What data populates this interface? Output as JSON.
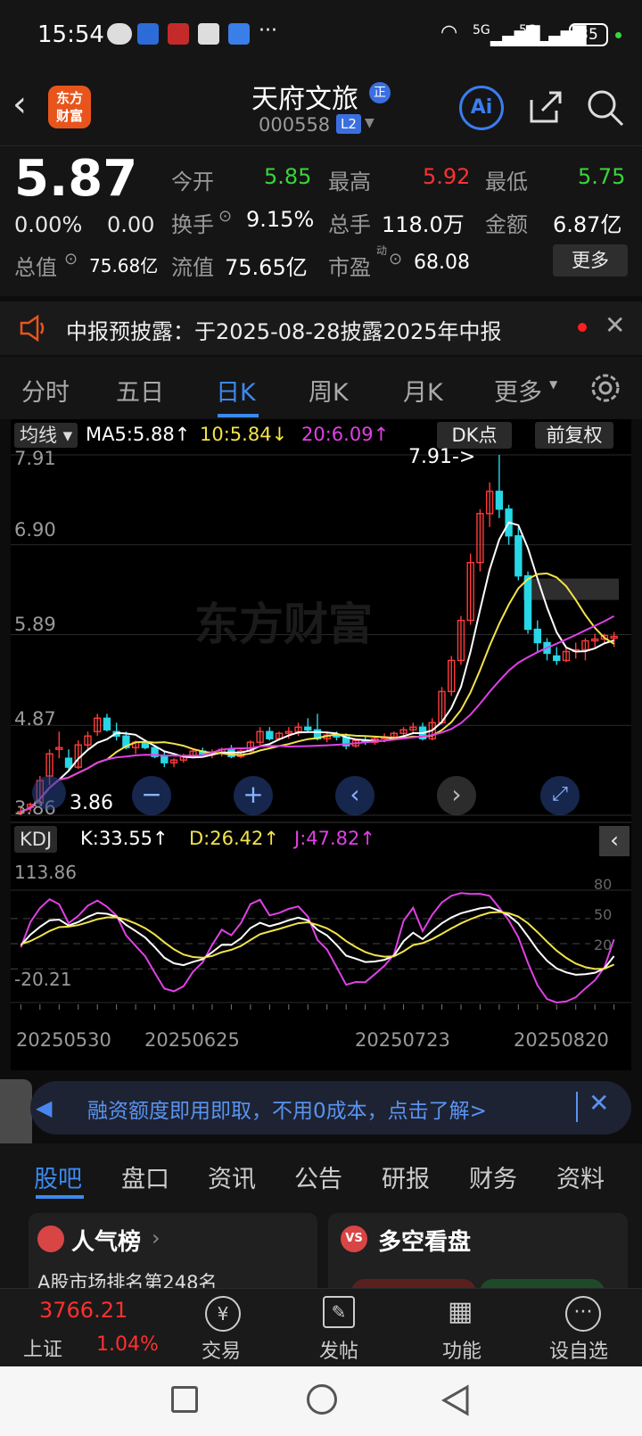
{
  "status": {
    "time": "15:54",
    "battery": "35",
    "net1": "5G",
    "net2": "5G"
  },
  "header": {
    "logo_line1": "东方",
    "logo_line2": "财富",
    "name": "天府文旅",
    "name_badge": "正",
    "code": "000558",
    "level": "L2",
    "ai_label": "Ai"
  },
  "quote": {
    "price": "5.87",
    "change_pct": "0.00%",
    "change": "0.00",
    "open_label": "今开",
    "open": "5.85",
    "high_label": "最高",
    "high": "5.92",
    "low_label": "最低",
    "low": "5.75",
    "turnover_label": "换手",
    "turnover": "9.15%",
    "volume_label": "总手",
    "volume": "118.0万",
    "amount_label": "金额",
    "amount": "6.87亿",
    "mktcap_label": "总值",
    "mktcap": "75.68亿",
    "float_label": "流值",
    "float": "75.65亿",
    "pe_label": "市盈",
    "pe_sup": "动",
    "pe": "68.08",
    "more": "更多"
  },
  "notice": {
    "text": "中报预披露：于2025-08-28披露2025年中报"
  },
  "tabs": [
    "分时",
    "五日",
    "日K",
    "周K",
    "月K",
    "更多"
  ],
  "tabs_active": 2,
  "chart": {
    "ma_label": "均线",
    "ma5": "MA5:5.88",
    "ma10": "10:5.84",
    "ma20": "20:6.09",
    "dk_btn": "DK点",
    "fq_btn": "前复权",
    "y_labels": [
      "7.91",
      "6.90",
      "5.89",
      "4.87",
      "3.86"
    ],
    "max_label": "7.91->",
    "min_label": "3.86",
    "watermark": "东方财富",
    "kdj_label": "KDJ",
    "k": "K:33.55",
    "d": "D:26.42",
    "j": "J:47.82",
    "kdj_top": "113.86",
    "kdj_bottom": "-20.21",
    "kdj_80": "80",
    "kdj_50": "50",
    "kdj_20": "20",
    "dates": [
      "20250530",
      "20250625",
      "20250723",
      "20250820"
    ]
  },
  "chart_data": {
    "type": "candlestick",
    "ylim": [
      3.86,
      7.91
    ],
    "ohlc": [
      [
        3.9,
        3.95,
        3.86,
        3.9
      ],
      [
        3.95,
        4.0,
        3.9,
        3.98
      ],
      [
        4.0,
        4.3,
        3.98,
        4.25
      ],
      [
        4.3,
        4.6,
        4.2,
        4.55
      ],
      [
        4.6,
        4.8,
        4.5,
        4.62
      ],
      [
        4.5,
        4.6,
        4.35,
        4.4
      ],
      [
        4.4,
        4.7,
        4.38,
        4.65
      ],
      [
        4.65,
        4.8,
        4.6,
        4.75
      ],
      [
        4.8,
        5.0,
        4.75,
        4.95
      ],
      [
        4.95,
        5.0,
        4.8,
        4.82
      ],
      [
        4.8,
        4.9,
        4.7,
        4.75
      ],
      [
        4.75,
        4.8,
        4.6,
        4.62
      ],
      [
        4.62,
        4.7,
        4.55,
        4.68
      ],
      [
        4.68,
        4.7,
        4.6,
        4.62
      ],
      [
        4.62,
        4.65,
        4.5,
        4.52
      ],
      [
        4.52,
        4.58,
        4.4,
        4.45
      ],
      [
        4.45,
        4.5,
        4.4,
        4.48
      ],
      [
        4.48,
        4.55,
        4.45,
        4.52
      ],
      [
        4.52,
        4.6,
        4.5,
        4.58
      ],
      [
        4.58,
        4.62,
        4.52,
        4.55
      ],
      [
        4.55,
        4.6,
        4.5,
        4.57
      ],
      [
        4.57,
        4.62,
        4.52,
        4.6
      ],
      [
        4.6,
        4.65,
        4.5,
        4.52
      ],
      [
        4.52,
        4.6,
        4.5,
        4.58
      ],
      [
        4.58,
        4.7,
        4.55,
        4.68
      ],
      [
        4.68,
        4.85,
        4.65,
        4.8
      ],
      [
        4.8,
        4.85,
        4.7,
        4.72
      ],
      [
        4.72,
        4.8,
        4.7,
        4.78
      ],
      [
        4.78,
        4.85,
        4.72,
        4.8
      ],
      [
        4.8,
        4.9,
        4.75,
        4.85
      ],
      [
        4.85,
        4.95,
        4.8,
        4.82
      ],
      [
        4.82,
        5.0,
        4.7,
        4.72
      ],
      [
        4.72,
        4.8,
        4.68,
        4.76
      ],
      [
        4.76,
        4.8,
        4.7,
        4.74
      ],
      [
        4.74,
        4.78,
        4.6,
        4.64
      ],
      [
        4.64,
        4.72,
        4.62,
        4.7
      ],
      [
        4.7,
        4.75,
        4.65,
        4.68
      ],
      [
        4.68,
        4.75,
        4.65,
        4.72
      ],
      [
        4.72,
        4.78,
        4.68,
        4.74
      ],
      [
        4.74,
        4.8,
        4.7,
        4.78
      ],
      [
        4.78,
        4.85,
        4.72,
        4.82
      ],
      [
        4.82,
        4.9,
        4.78,
        4.85
      ],
      [
        4.85,
        4.9,
        4.7,
        4.72
      ],
      [
        4.72,
        4.95,
        4.7,
        4.9
      ],
      [
        4.9,
        5.3,
        4.88,
        5.25
      ],
      [
        5.25,
        5.65,
        5.2,
        5.6
      ],
      [
        5.6,
        6.1,
        5.55,
        6.05
      ],
      [
        6.05,
        6.8,
        6.0,
        6.7
      ],
      [
        6.7,
        7.3,
        6.6,
        7.25
      ],
      [
        7.25,
        7.6,
        7.1,
        7.5
      ],
      [
        7.5,
        7.91,
        7.2,
        7.3
      ],
      [
        7.3,
        7.35,
        6.9,
        7.0
      ],
      [
        7.0,
        7.1,
        6.5,
        6.55
      ],
      [
        6.55,
        6.6,
        5.9,
        5.95
      ],
      [
        5.95,
        6.05,
        5.7,
        5.8
      ],
      [
        5.8,
        5.85,
        5.6,
        5.68
      ],
      [
        5.65,
        5.75,
        5.55,
        5.6
      ],
      [
        5.6,
        5.75,
        5.58,
        5.7
      ],
      [
        5.7,
        5.8,
        5.62,
        5.72
      ],
      [
        5.72,
        5.85,
        5.6,
        5.82
      ],
      [
        5.82,
        5.9,
        5.75,
        5.84
      ],
      [
        5.84,
        5.9,
        5.78,
        5.88
      ],
      [
        5.85,
        5.92,
        5.75,
        5.87
      ]
    ],
    "series": [
      {
        "name": "MA5",
        "color": "#ffffff"
      },
      {
        "name": "MA10",
        "color": "#f2e34a"
      },
      {
        "name": "MA20",
        "color": "#e040e6"
      }
    ]
  },
  "ad": {
    "text": "融资额度即用即取，不用0成本，点击了解>"
  },
  "subtabs": [
    "股吧",
    "盘口",
    "资讯",
    "公告",
    "研报",
    "财务",
    "资料"
  ],
  "cards": {
    "left_title": "人气榜",
    "left_sub": "A股市场排名第248名",
    "right_title": "多空看盘",
    "right_icon": "VS"
  },
  "bottom": {
    "index_value": "3766.21",
    "index_name": "上证",
    "index_pct": "1.04%",
    "items": [
      "交易",
      "发帖",
      "功能",
      "设自选"
    ]
  }
}
